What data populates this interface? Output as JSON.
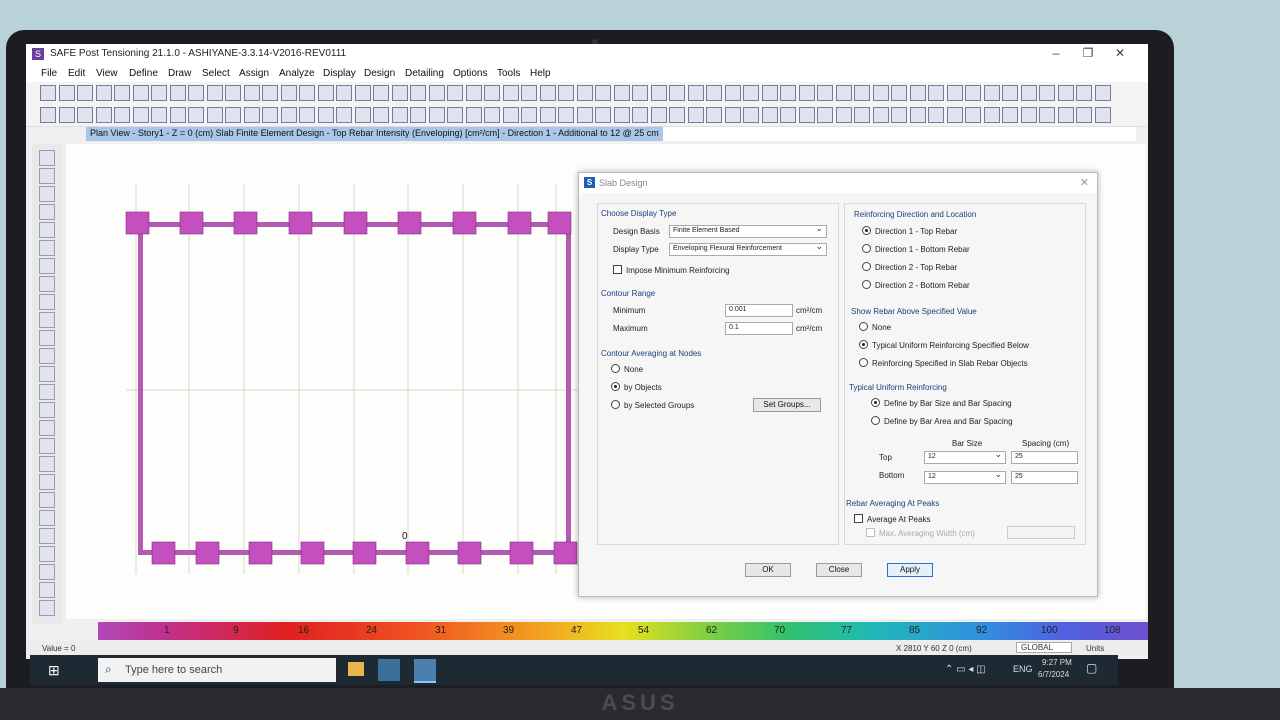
{
  "window": {
    "title": "SAFE Post Tensioning 21.1.0 - ASHIYANE-3.3.14-V2016-REV0111"
  },
  "menu": [
    "File",
    "Edit",
    "View",
    "Define",
    "Draw",
    "Select",
    "Assign",
    "Analyze",
    "Display",
    "Design",
    "Detailing",
    "Options",
    "Tools",
    "Help"
  ],
  "tab": {
    "label": "Plan View - Story1 - Z = 0 (cm)  Slab Finite Element Design - Top Rebar Intensity (Enveloping) [cm²/cm] - Direction 1 - Additional to 12 @ 25 cm"
  },
  "plan": {
    "point_label": "0"
  },
  "legend": {
    "values": [
      "1",
      "9",
      "16",
      "24",
      "31",
      "39",
      "47",
      "54",
      "62",
      "70",
      "77",
      "85",
      "92",
      "100",
      "108"
    ]
  },
  "status": {
    "left": "Value = 0",
    "coords": "X 2810  Y 60  Z 0 (cm)",
    "system": "GLOBAL",
    "units": "Units"
  },
  "taskbar": {
    "search_placeholder": "Type here to search",
    "lang": "ENG",
    "time": "9:27 PM",
    "date": "6/7/2024"
  },
  "dialog": {
    "title": "Slab Design",
    "display_type": {
      "heading": "Choose Display Type",
      "design_basis_label": "Design Basis",
      "design_basis_value": "Finite Element Based",
      "display_type_label": "Display Type",
      "display_type_value": "Enveloping Flexural Reinforcement",
      "impose_min": "Impose Minimum Reinforcing"
    },
    "contour_range": {
      "heading": "Contour Range",
      "min_label": "Minimum",
      "min_value": "0.001",
      "min_unit": "cm²/cm",
      "max_label": "Maximum",
      "max_value": "0.1",
      "max_unit": "cm²/cm"
    },
    "averaging": {
      "heading": "Contour Averaging at Nodes",
      "none": "None",
      "by_objects": "by Objects",
      "by_groups": "by Selected Groups",
      "set_groups": "Set Groups..."
    },
    "direction": {
      "heading": "Reinforcing Direction and Location",
      "d1_top": "Direction 1 - Top Rebar",
      "d1_bottom": "Direction 1 - Bottom Rebar",
      "d2_top": "Direction 2 - Top Rebar",
      "d2_bottom": "Direction 2 - Bottom Rebar"
    },
    "show_rebar": {
      "heading": "Show Rebar Above Specified Value",
      "none": "None",
      "typical": "Typical Uniform Reinforcing Specified Below",
      "objects": "Reinforcing Specified in Slab Rebar Objects"
    },
    "typical": {
      "heading": "Typical Uniform Reinforcing",
      "by_size": "Define by Bar Size and Bar Spacing",
      "by_area": "Define by Bar Area and Bar Spacing",
      "col_size": "Bar Size",
      "col_spacing": "Spacing  (cm)",
      "top_label": "Top",
      "top_size": "12",
      "top_spacing": "25",
      "bottom_label": "Bottom",
      "bottom_size": "12",
      "bottom_spacing": "25"
    },
    "peaks": {
      "heading": "Rebar Averaging At Peaks",
      "average": "Average At Peaks",
      "max_width": "Max. Averaging Width  (cm)"
    },
    "buttons": {
      "ok": "OK",
      "close": "Close",
      "apply": "Apply"
    }
  }
}
